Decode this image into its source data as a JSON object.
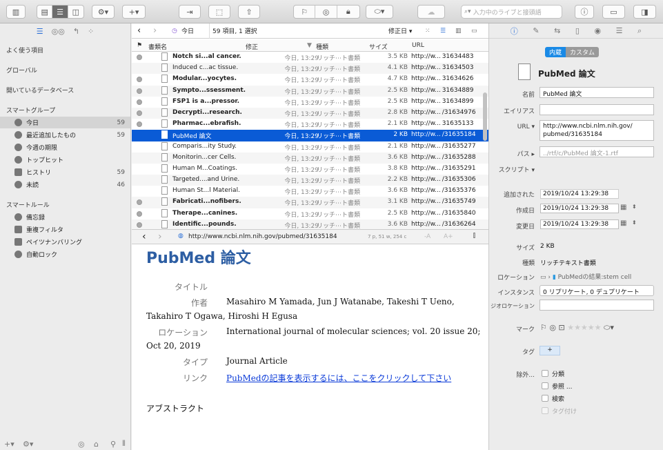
{
  "toolbar": {
    "search_placeholder": "入力中のライブと接頭語"
  },
  "sidebar": {
    "tabs": [
      "☰",
      "◎◎",
      "↰",
      "⁘"
    ],
    "sections": {
      "favorites": "よく使う項目",
      "global": "グローバル",
      "open_db": "開いているデータベース",
      "smart_groups": "スマートグループ",
      "smart_rules": "スマートルール"
    },
    "groups": [
      {
        "label": "今日",
        "count": "59"
      },
      {
        "label": "最近追加したもの",
        "count": "59"
      },
      {
        "label": "今週の期限",
        "count": ""
      },
      {
        "label": "トップヒット",
        "count": ""
      },
      {
        "label": "ヒストリ",
        "count": "59"
      },
      {
        "label": "未読",
        "count": "46"
      }
    ],
    "rules": [
      {
        "label": "備忘録"
      },
      {
        "label": "重複フィルタ"
      },
      {
        "label": "ペイツナンバリング"
      },
      {
        "label": "自動ロック"
      }
    ]
  },
  "list": {
    "nav_location": "今日",
    "count_text": "59 項目, 1 選択",
    "sort_text": "修正日",
    "columns": {
      "name": "書類名",
      "modified": "修正",
      "kind": "種類",
      "size": "サイズ",
      "url": "URL"
    },
    "rows": [
      {
        "name": "Notch si...al cancer.",
        "modified": "今日, 13:29",
        "kind": "リッチ⋯ト書類",
        "size": "3.5 KB",
        "url": "http://w...",
        "id": "31634483",
        "dot": true,
        "bold": true
      },
      {
        "name": "Induced c...ac tissue.",
        "modified": "今日, 13:29",
        "kind": "リッチ⋯ト書類",
        "size": "4.1 KB",
        "url": "http://w...",
        "id": "31634503",
        "dot": false,
        "bold": false
      },
      {
        "name": "Modular...yocytes.",
        "modified": "今日, 13:29",
        "kind": "リッチ⋯ト書類",
        "size": "4.7 KB",
        "url": "http://w...",
        "id": "31634626",
        "dot": true,
        "bold": true
      },
      {
        "name": "Sympto...ssessment.",
        "modified": "今日, 13:29",
        "kind": "リッチ⋯ト書類",
        "size": "2.5 KB",
        "url": "http://w...",
        "id": "31634889",
        "dot": true,
        "bold": true
      },
      {
        "name": "FSP1 is a...pressor.",
        "modified": "今日, 13:29",
        "kind": "リッチ⋯ト書類",
        "size": "2.5 KB",
        "url": "http://w...",
        "id": "31634899",
        "dot": true,
        "bold": true
      },
      {
        "name": "Decrypti...research.",
        "modified": "今日, 13:29",
        "kind": "リッチ⋯ト書類",
        "size": "2.8 KB",
        "url": "http://w...",
        "id": "/31634976",
        "dot": true,
        "bold": true
      },
      {
        "name": "Pharmac...ebrafish.",
        "modified": "今日, 13:29",
        "kind": "リッチ⋯ト書類",
        "size": "2.1 KB",
        "url": "http://w...",
        "id": "31635133",
        "dot": true,
        "bold": true
      },
      {
        "name": "PubMed 論文",
        "modified": "今日, 13:29",
        "kind": "リッチ⋯ト書類",
        "size": "2 KB",
        "url": "http://w...",
        "id": "/31635184",
        "dot": false,
        "bold": false,
        "selected": true
      },
      {
        "name": "Comparis...ity Study.",
        "modified": "今日, 13:29",
        "kind": "リッチ⋯ト書類",
        "size": "2.1 KB",
        "url": "http://w...",
        "id": "/31635277",
        "dot": false,
        "bold": false
      },
      {
        "name": "Monitorin...cer Cells.",
        "modified": "今日, 13:29",
        "kind": "リッチ⋯ト書類",
        "size": "3.6 KB",
        "url": "http://w...",
        "id": "/31635288",
        "dot": false,
        "bold": false
      },
      {
        "name": "Human M...Coatings.",
        "modified": "今日, 13:29",
        "kind": "リッチ⋯ト書類",
        "size": "3.8 KB",
        "url": "http://w...",
        "id": "/31635291",
        "dot": false,
        "bold": false
      },
      {
        "name": "Targeted....and Urine.",
        "modified": "今日, 13:29",
        "kind": "リッチ⋯ト書類",
        "size": "2.2 KB",
        "url": "http://w...",
        "id": "/31635306",
        "dot": false,
        "bold": false
      },
      {
        "name": "Human St...l Material.",
        "modified": "今日, 13:29",
        "kind": "リッチ⋯ト書類",
        "size": "3.6 KB",
        "url": "http://w...",
        "id": "/31635376",
        "dot": false,
        "bold": false
      },
      {
        "name": "Fabricati...nofibers.",
        "modified": "今日, 13:29",
        "kind": "リッチ⋯ト書類",
        "size": "3.1 KB",
        "url": "http://w...",
        "id": "/31635749",
        "dot": true,
        "bold": true
      },
      {
        "name": "Therape...canines.",
        "modified": "今日, 13:29",
        "kind": "リッチ⋯ト書類",
        "size": "2.5 KB",
        "url": "http://w...",
        "id": "/31635840",
        "dot": true,
        "bold": true
      },
      {
        "name": "Identific...pounds.",
        "modified": "今日, 13:29",
        "kind": "リッチ⋯ト書類",
        "size": "3.6 KB",
        "url": "http://w...",
        "id": "/31636264",
        "dot": true,
        "bold": true
      }
    ]
  },
  "preview": {
    "url": "http://www.ncbi.nlm.nih.gov/pubmed/31635184",
    "stats": "7 p, 51 w, 254 c",
    "title": "PubMed 論文",
    "title_label": "タイトル",
    "author_label": "作者",
    "author_value": "Masahiro M Yamada, Jun J Watanabe, Takeshi T Ueno,",
    "author_value2": "Takahiro T Ogawa, Hiroshi H Egusa",
    "location_label": "ロケーション",
    "location_value": "International journal of molecular sciences; vol. 20 issue 20;",
    "location_value2": "Oct 20, 2019",
    "type_label": "タイプ",
    "type_value": "Journal Article",
    "link_label": "リンク",
    "link_value": "PubMedの記事を表示するには、ここをクリックして下さい",
    "abstract_label": "アブストラクト"
  },
  "inspector": {
    "seg_on": "内蔵",
    "seg_off": "カスタム",
    "doc_title": "PubMed 論文",
    "name_label": "名前",
    "name_value": "PubMed 論文",
    "alias_label": "エイリアス",
    "url_label": "URL",
    "url_value": "http://www.ncbi.nlm.nih.gov/",
    "url_value2": "pubmed/31635184",
    "path_label": "パス",
    "path_value": "../rtf/c/PubMed 論文-1.rtf",
    "script_label": "スクリプト",
    "added_label": "追加された",
    "added_value": "2019/10/24 13:29:38",
    "created_label": "作成日",
    "created_value": "2019/10/24 13:29:38",
    "modified_label": "変更日",
    "modified_value": "2019/10/24 13:29:38",
    "size_label": "サイズ",
    "size_value": "2 KB",
    "kind_label": "種類",
    "kind_value": "リッチテキスト書類",
    "location_label": "ロケーション",
    "location_value": "PubMedの結果:stem cell",
    "instance_label": "インスタンス",
    "instance_value": "0 リプリケート, 0 デュプリケート",
    "geo_label": "ジオロケーション",
    "mark_label": "マーク",
    "tag_label": "タグ",
    "exclude_label": "除外...",
    "exclude_opts": [
      "分類",
      "参照 ...",
      "検索",
      "タグ付け"
    ]
  }
}
